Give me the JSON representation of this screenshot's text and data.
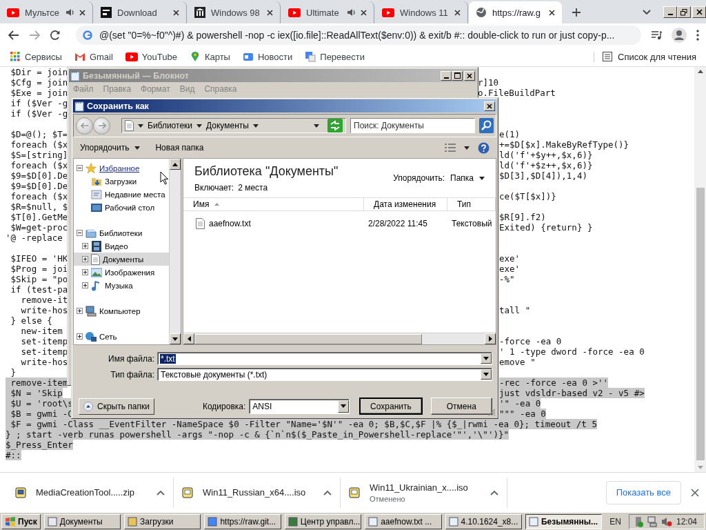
{
  "browser": {
    "tabs": [
      {
        "title": "Мультсе",
        "audio": true,
        "selected": false
      },
      {
        "title": "Download",
        "audio": false,
        "selected": false
      },
      {
        "title": "Windows 98",
        "audio": false,
        "selected": false
      },
      {
        "title": "Ultimate",
        "audio": true,
        "selected": false
      },
      {
        "title": "Windows 11",
        "audio": false,
        "selected": false
      },
      {
        "title": "https://raw.g",
        "audio": false,
        "selected": true
      }
    ],
    "address": "@(set \"0=%~f0\"^)#) & powershell -nop -c iex([io.file]::ReadAllText($env:0)) & exit/b #:: double-click to run or just copy-p...",
    "bookmarks": [
      "Сервисы",
      "Gmail",
      "YouTube",
      "Карты",
      "Новости",
      "Перевести"
    ],
    "reading_list": "Список для чтения"
  },
  "code": {
    "lines": [
      {
        "kind": "code",
        "left": " $Dir = join",
        "highlighted": false
      },
      {
        "kind": "code",
        "left": " $Cfg = join",
        "right": "r]10",
        "highlighted": false
      },
      {
        "kind": "code",
        "left": " $Exe = join",
        "right": "o.FileBuildPart",
        "highlighted": false
      },
      {
        "kind": "code",
        "left": " if ($Ver -g",
        "highlighted": false
      },
      {
        "kind": "code",
        "left": " if ($Ver -g",
        "highlighted": false
      },
      {
        "kind": "blank"
      },
      {
        "left": " $D=@(); $T=",
        "right": "e(1)",
        "highlighted": false
      },
      {
        "left": " foreach ($x",
        "right": "+=$D[$x].MakeByRefType()}",
        "highlighted": false
      },
      {
        "left": " $S=[string]",
        "right": "ld('f'+$y++,$x,6)}",
        "highlighted": false
      },
      {
        "left": " foreach ($x",
        "right": "ld('f'+$z++,$x,6)}",
        "highlighted": false
      },
      {
        "left": " $9=$D[0].De",
        "right": "$D[3],$D[4]),1,4)",
        "highlighted": false
      },
      {
        "left": " $9=$D[0].De",
        "highlighted": false
      },
      {
        "left": " foreach ($x",
        "right": "ce($T[$x])}",
        "highlighted": false
      },
      {
        "left": " $R=$null, $",
        "highlighted": false
      },
      {
        "left": " $T[0].GetMe",
        "right": "$R[9].f2)",
        "highlighted": false
      },
      {
        "left": " $W=get-proc",
        "right": "Exited) {return} }",
        "highlighted": false
      },
      {
        "left": "'@ -replace",
        "highlighted": false
      },
      {
        "kind": "blank"
      },
      {
        "left": " $IFEO = 'HK",
        "right": "exe'",
        "highlighted": false
      },
      {
        "left": " $Prog = joi",
        "right": "exe'",
        "highlighted": false
      },
      {
        "left": " $Skip = \"po",
        "right": "-%\"",
        "highlighted": false
      },
      {
        "left": " if (test-pa",
        "highlighted": false
      },
      {
        "left": "   remove-it",
        "highlighted": false
      },
      {
        "left": "   write-hos",
        "right": "tall \"",
        "highlighted": false
      },
      {
        "left": " } else {",
        "highlighted": false
      },
      {
        "left": "   new-item",
        "highlighted": false
      },
      {
        "left": "   set-itemp",
        "right": "-force -ea 0",
        "highlighted": false
      },
      {
        "left": "   set-itemp",
        "right": "' 1 -type dword -force -ea 0",
        "highlighted": false
      },
      {
        "left": "   write-hos",
        "right": "emove \"",
        "highlighted": false
      },
      {
        "left": " }",
        "highlighted": false
      },
      {
        "left": " remove-item",
        "right": "-rec -force -ea 0 >''",
        "highlighted": true
      },
      {
        "left": " $N = 'Skip",
        "right": "just vdsldr-based v2 - v5 #>",
        "highlighted": true
      },
      {
        "left": " $U = 'root\\s",
        "right": "'\" -ea 0",
        "highlighted": true
      },
      {
        "left": " $B = gwmi -C",
        "right": "\"\"\" -ea 0",
        "highlighted": true
      },
      {
        "left": " $F = gwmi -Class __EventFilter -NameSpace $0 -Filter \"Name='$N'\" -ea 0; $B,$C,$F |% {$_|rwmi -ea 0}; timeout /t 5",
        "highlighted": true
      },
      {
        "left": "} ; start -verb runas powershell -args \"-nop -c & {`n`n$($_Paste_in_Powershell-replace'\"','\\\"')}\"",
        "highlighted": true
      },
      {
        "left": "$_Press_Enter",
        "highlighted": true
      },
      {
        "left": "#::",
        "highlighted": true
      }
    ]
  },
  "notepad": {
    "title": "Безымянный — Блокнот",
    "menu": [
      "Файл",
      "Правка",
      "Формат",
      "Вид",
      "Справка"
    ]
  },
  "save_dialog": {
    "title": "Сохранить как",
    "breadcrumb": [
      "Библиотеки",
      "Документы"
    ],
    "search_placeholder": "Поиск: Документы",
    "organize": "Упорядочить",
    "new_folder": "Новая папка",
    "nav_tree": [
      {
        "label": "Избранное",
        "expanded": true,
        "selected": false,
        "hovered": true,
        "children": [
          {
            "label": "Загрузки",
            "selected": false
          },
          {
            "label": "Недавние места",
            "selected": false
          },
          {
            "label": "Рабочий стол",
            "selected": false
          }
        ]
      },
      {
        "label": "Библиотеки",
        "expanded": true,
        "selected": false,
        "hovered": false,
        "children": [
          {
            "label": "Видео",
            "expanded": false,
            "selected": false
          },
          {
            "label": "Документы",
            "expanded": false,
            "selected": true
          },
          {
            "label": "Изображения",
            "expanded": false,
            "selected": false
          },
          {
            "label": "Музыка",
            "expanded": false,
            "selected": false
          }
        ]
      },
      {
        "label": "Компьютер",
        "expanded": false,
        "selected": false,
        "hovered": false
      },
      {
        "label": "Сеть",
        "expanded": false,
        "selected": false,
        "hovered": false
      }
    ],
    "library_title": "Библиотека \"Документы\"",
    "includes_label": "Включает:",
    "includes_value": "2 места",
    "arrange_label": "Упорядочить:",
    "arrange_value": "Папка",
    "columns": [
      "Имя",
      "Дата изменения",
      "Тип"
    ],
    "files": [
      {
        "name": "aaefnow.txt",
        "date": "2/28/2022 11:45",
        "type": "Текстовый"
      }
    ],
    "file_name_label": "Имя файла:",
    "file_name": "*.txt",
    "file_type_label": "Тип файла:",
    "file_type": "Текстовые документы (*.txt)",
    "hide_folders": "Скрыть папки",
    "encoding_label": "Кодировка:",
    "encoding": "ANSI",
    "buttons": [
      {
        "label": "Сохранить",
        "default": true
      },
      {
        "label": "Отмена",
        "default": false
      }
    ]
  },
  "downloads": {
    "items": [
      {
        "name": "MediaCreationTool.....zip"
      },
      {
        "name": "Win11_Russian_x64....iso"
      },
      {
        "name": "Win11_Ukrainian_x....iso",
        "status": "Отменено"
      }
    ],
    "show_all": "Показать все"
  },
  "taskbar": {
    "start": "Пуск",
    "items": [
      {
        "label": "Документы",
        "selected": false
      },
      {
        "label": "Загрузки",
        "selected": false
      },
      {
        "label": "https://raw.git...",
        "selected": false
      },
      {
        "label": "Центр управл...",
        "selected": false
      },
      {
        "label": "aaefnow.txt ...",
        "selected": false
      },
      {
        "label": "4.10.1624_x8...",
        "selected": false
      },
      {
        "label": "Безымянны...",
        "selected": true
      }
    ],
    "language": "EN",
    "clock": "12:04"
  }
}
